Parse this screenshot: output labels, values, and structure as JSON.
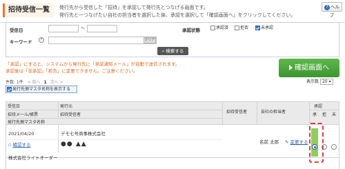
{
  "header": {
    "title": "招待受信一覧",
    "desc_line1": "発行先から受信した「招待」を承認して発行先とつなげる画面です。",
    "desc_line2": "発行先と一つなげたい自社の担当者を選択した後、承認を選択して「確認画面へ」をクリックしてください。",
    "help_label": "ヘルプ"
  },
  "search": {
    "received_date_label": "受信日",
    "date_separator": "〜",
    "keyword_label": "キーワード",
    "keyword_help": "?",
    "clear_label": "クリア",
    "status_label": "承認状態",
    "status_options": [
      {
        "label": "承認済",
        "checked": false
      },
      {
        "label": "拒否",
        "checked": false
      },
      {
        "label": "未承認",
        "checked": true
      }
    ],
    "search_button": "検索する"
  },
  "notice": {
    "line1": "「承認」にすると、システムから発行先に「承認通知メール」が自動で送信されます。",
    "line2": "承認後は「非承認」「拒否」に変更できません。ご注意ください。"
  },
  "confirm_button": "確認画面へ",
  "pager": {
    "count_text": "件数: 1件",
    "prev": "< 前へ",
    "page": "1",
    "next": "次へ >",
    "display_count_label": "表示数",
    "display_count_value": "20"
  },
  "master_toggle_label": "発行先側マスタ名称を表示する",
  "table": {
    "headers": {
      "received_date": "受信日",
      "issuer": "発行元",
      "invite_mail": "招待メール/帳票",
      "invite_recipient": "招待受信者",
      "issuer_master": "発行先側マスタ名称",
      "approval_recipient": "招待受信者",
      "own_staff": "自社の担当者",
      "approve": "承認",
      "approve_col": "承",
      "reject_col": "拒",
      "pending_col": "未"
    },
    "row": {
      "date": "2021/04/20",
      "issuer_company": "デモ七号商事株式会社",
      "confirm_link": "確認する",
      "recipient_marks": "●● ▲▲",
      "staff_name": "名前 太郎",
      "change_link": "変更する",
      "master_name": "株式会社ライトオーダー"
    }
  },
  "colors": {
    "accent_orange": "#e8762c",
    "confirm_green": "#4aa83a",
    "approve_highlight": "#8ad05a",
    "dash_red": "#e23c3c",
    "link_blue": "#2a5fa8"
  }
}
